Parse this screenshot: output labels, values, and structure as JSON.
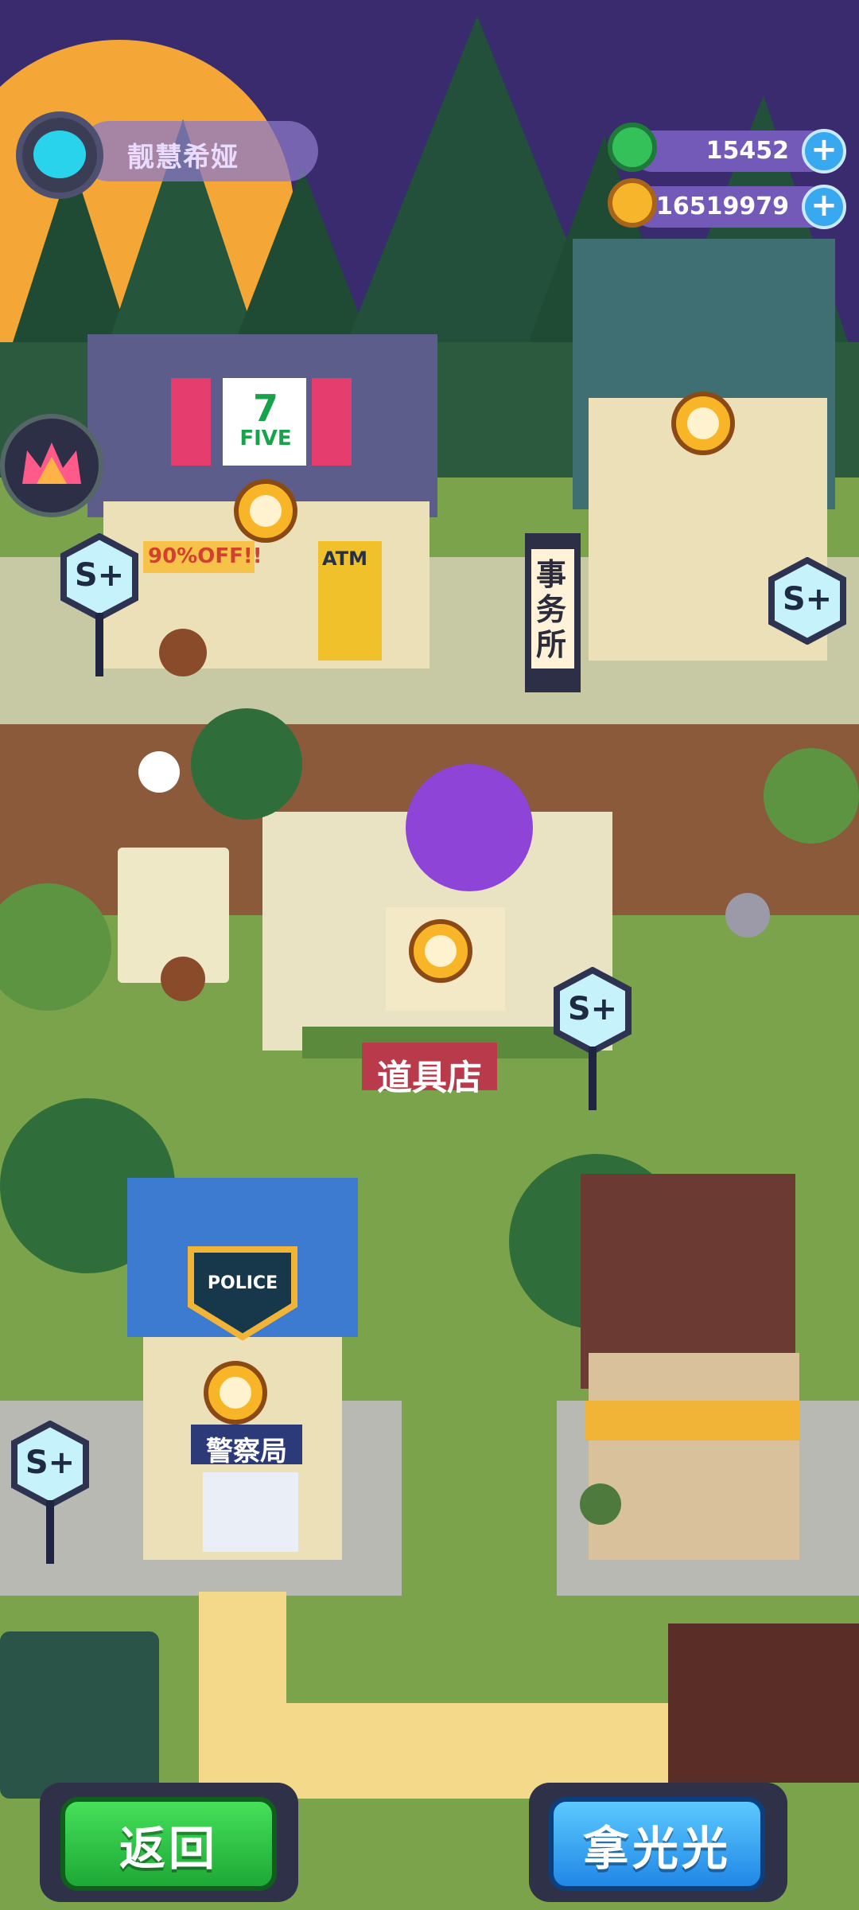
{
  "player": {
    "name": "靓慧希娅",
    "avatar_icon": "cat-face-icon"
  },
  "currencies": [
    {
      "name": "green-gem",
      "icon": "green-coin-icon",
      "value": "15452"
    },
    {
      "name": "gold-planet",
      "icon": "planet-coin-icon",
      "value": "16519979"
    }
  ],
  "plus_label": "+",
  "badges": {
    "label": "S+"
  },
  "buildings": {
    "convenience_store": {
      "logo_number": "7",
      "logo_text": "FIVE",
      "sale_sign": "90%OFF!!",
      "atm": "ATM"
    },
    "office": {
      "sign": "事务所"
    },
    "item_shop": {
      "sign": "道具店"
    },
    "police": {
      "badge_text": "POLICE",
      "sign": "警察局"
    }
  },
  "buttons": {
    "back": "返回",
    "take_all": "拿光光"
  },
  "colors": {
    "sky": "#3a2a6e",
    "moon": "#f4a737",
    "grass": "#7aa34b",
    "road": "#8a5a3a",
    "back_button": "#2fc447",
    "take_button": "#3aa6f2"
  }
}
